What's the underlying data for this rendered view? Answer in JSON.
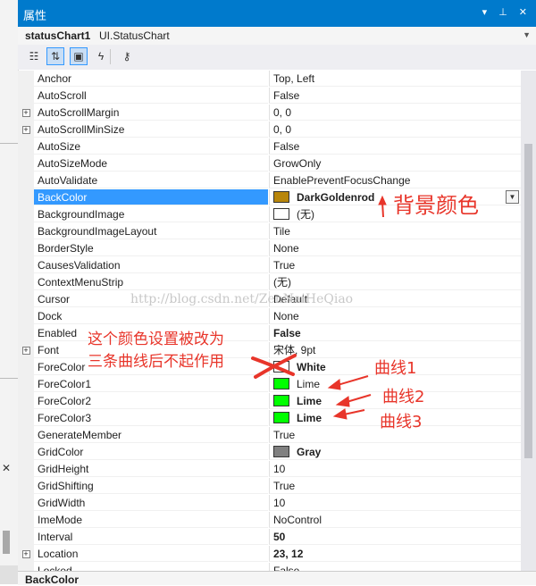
{
  "window": {
    "title": "属性",
    "pin": "▾  ⊥  ✕"
  },
  "object": {
    "name": "statusChart1",
    "type": "UI.StatusChart"
  },
  "toolbar": {
    "buttons": [
      {
        "icon": "categorized-icon",
        "glyph": "☷",
        "active": false
      },
      {
        "icon": "alphabetical-icon",
        "glyph": "⇅",
        "active": true
      },
      {
        "icon": "properties-icon",
        "glyph": "▣",
        "active": true
      },
      {
        "icon": "events-icon",
        "glyph": "ϟ",
        "active": false
      },
      {
        "icon": "property-pages-icon",
        "glyph": "⚷",
        "active": false
      }
    ]
  },
  "properties": [
    {
      "name": "Anchor",
      "value": "Top, Left"
    },
    {
      "name": "AutoScroll",
      "value": "False"
    },
    {
      "name": "AutoScrollMargin",
      "value": "0, 0",
      "expandable": true
    },
    {
      "name": "AutoScrollMinSize",
      "value": "0, 0",
      "expandable": true
    },
    {
      "name": "AutoSize",
      "value": "False"
    },
    {
      "name": "AutoSizeMode",
      "value": "GrowOnly"
    },
    {
      "name": "AutoValidate",
      "value": "EnablePreventFocusChange"
    },
    {
      "name": "BackColor",
      "value": "DarkGoldenrod",
      "swatch": "#b8860b",
      "bold": true,
      "selected": true
    },
    {
      "name": "BackgroundImage",
      "value": "(无)",
      "swatch": "#ffffff"
    },
    {
      "name": "BackgroundImageLayout",
      "value": "Tile"
    },
    {
      "name": "BorderStyle",
      "value": "None"
    },
    {
      "name": "CausesValidation",
      "value": "True"
    },
    {
      "name": "ContextMenuStrip",
      "value": "(无)"
    },
    {
      "name": "Cursor",
      "value": "Default"
    },
    {
      "name": "Dock",
      "value": "None"
    },
    {
      "name": "Enabled",
      "value": "False",
      "bold": true
    },
    {
      "name": "Font",
      "value": "宋体, 9pt",
      "expandable": true
    },
    {
      "name": "ForeColor",
      "value": "White",
      "swatch": "#ffffff",
      "bold": true
    },
    {
      "name": "ForeColor1",
      "value": "Lime",
      "swatch": "#00ff00"
    },
    {
      "name": "ForeColor2",
      "value": "Lime",
      "swatch": "#00ff00",
      "bold": true
    },
    {
      "name": "ForeColor3",
      "value": "Lime",
      "swatch": "#00ff00",
      "bold": true
    },
    {
      "name": "GenerateMember",
      "value": "True"
    },
    {
      "name": "GridColor",
      "value": "Gray",
      "swatch": "#808080",
      "bold": true
    },
    {
      "name": "GridHeight",
      "value": "10"
    },
    {
      "name": "GridShifting",
      "value": "True"
    },
    {
      "name": "GridWidth",
      "value": "10"
    },
    {
      "name": "ImeMode",
      "value": "NoControl"
    },
    {
      "name": "Interval",
      "value": "50",
      "bold": true
    },
    {
      "name": "Location",
      "value": "23, 12",
      "bold": true,
      "expandable": true
    },
    {
      "name": "Locked",
      "value": "False"
    }
  ],
  "description": {
    "title": "BackColor"
  },
  "watermark": "http://blog.csdn.net/ZenNaiHeQiao",
  "annotations": {
    "background_color": "背景颜色",
    "note_line1": "这个颜色设置被改为",
    "note_line2": "三条曲线后不起作用",
    "curve1": "曲线1",
    "curve2": "曲线2",
    "curve3": "曲线3",
    "color": "#e8352a"
  },
  "colors": {
    "titlebar": "#007acc",
    "selection": "#3399ff"
  }
}
